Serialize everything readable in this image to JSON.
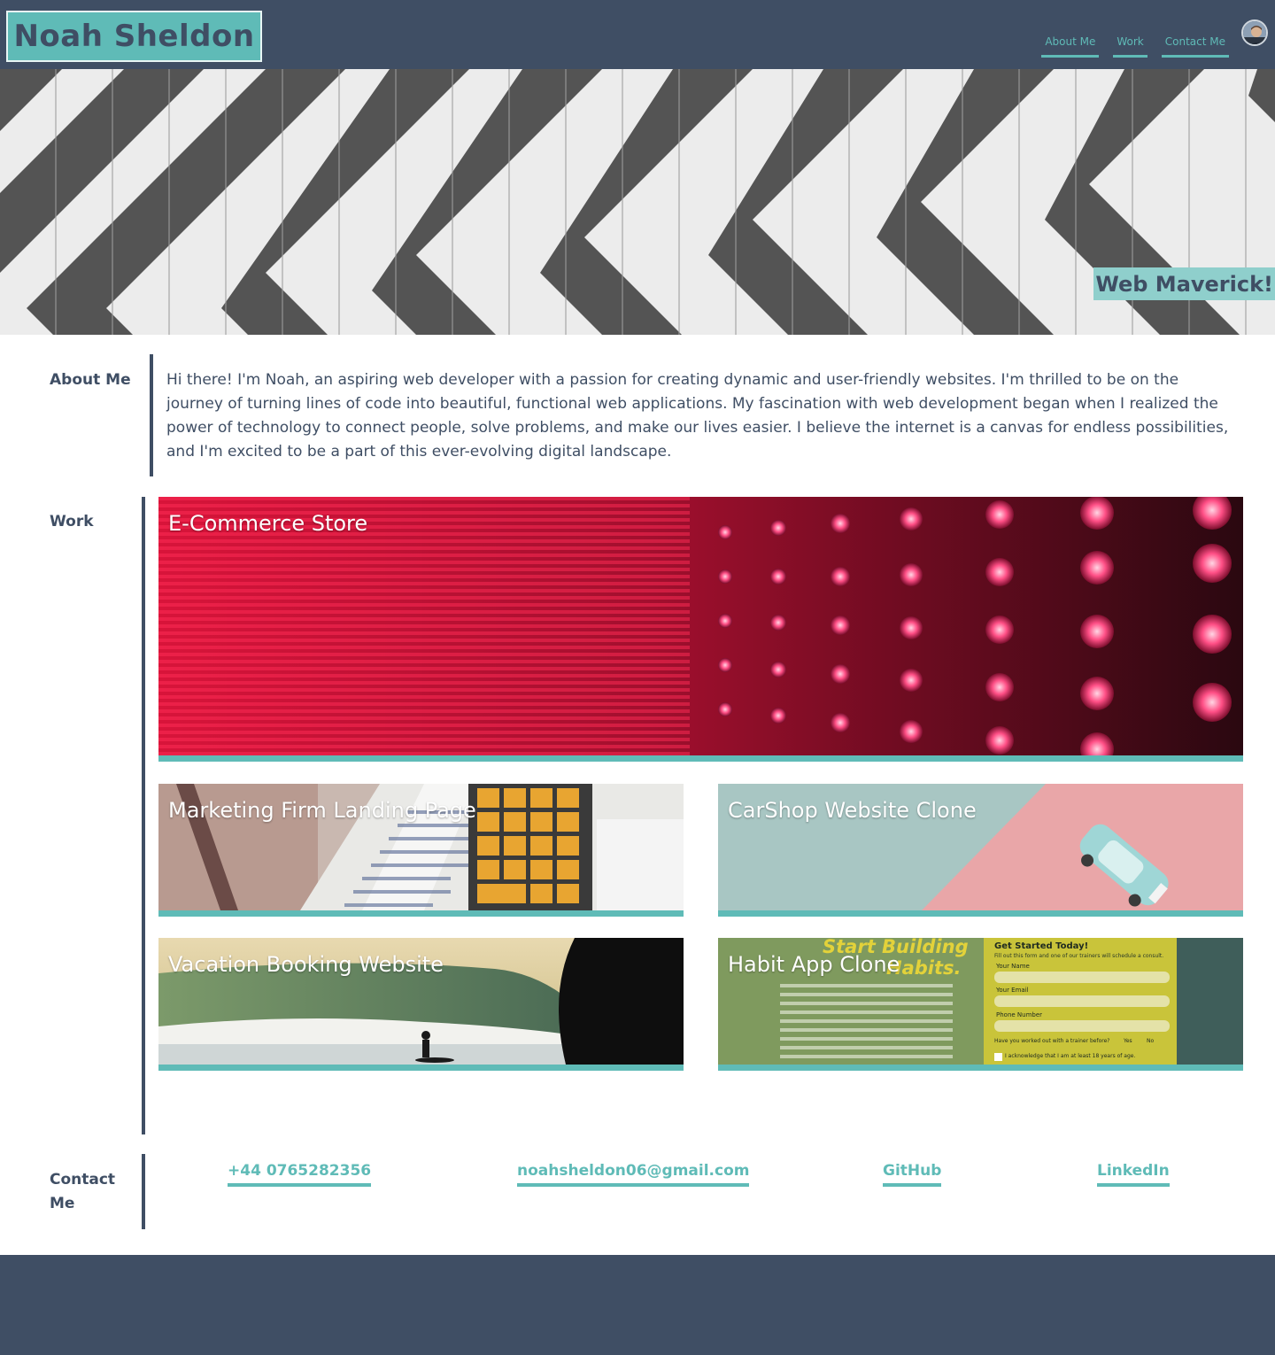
{
  "header": {
    "name": "Noah Sheldon",
    "nav": [
      {
        "label": "About Me"
      },
      {
        "label": "Work"
      },
      {
        "label": "Contact Me"
      }
    ]
  },
  "hero": {
    "tagline": "Web Maverick!"
  },
  "about": {
    "heading": "About Me",
    "text": "Hi there! I'm Noah, an aspiring web developer with a passion for creating dynamic and user-friendly websites. I'm thrilled to be on the journey of turning lines of code into beautiful, functional web applications. My fascination with web development began when I realized the power of technology to connect people, solve problems, and make our lives easier. I believe the internet is a canvas for endless possibilities, and I'm excited to be a part of this ever-evolving digital landscape."
  },
  "work": {
    "heading": "Work",
    "projects": [
      {
        "title": "E-Commerce Store"
      },
      {
        "title": "Marketing Firm Landing Page"
      },
      {
        "title": "CarShop Website Clone"
      },
      {
        "title": "Vacation Booking Website"
      },
      {
        "title": "Habit App Clone"
      }
    ],
    "habit_app_preview": {
      "headline_1": "Start Building",
      "headline_2": "Habits.",
      "form_title": "Get Started Today!",
      "form_sub": "Fill out this form and one of our trainers will schedule a consult.",
      "fields": [
        "Your Name",
        "Your Email",
        "Phone Number"
      ],
      "question": "Have you worked out with a trainer before?",
      "yes": "Yes",
      "no": "No",
      "ack": "I acknowledge that I am at least 18 years of age."
    }
  },
  "contact": {
    "heading_line1": "Contact",
    "heading_line2": "Me",
    "phone": "+44 0765282356",
    "email": "noahsheldon06@gmail.com",
    "github": "GitHub",
    "linkedin": "LinkedIn"
  },
  "colors": {
    "primary": "#3f4e64",
    "accent": "#5fbbb7",
    "tagline_bg": "#8fcfcc"
  }
}
